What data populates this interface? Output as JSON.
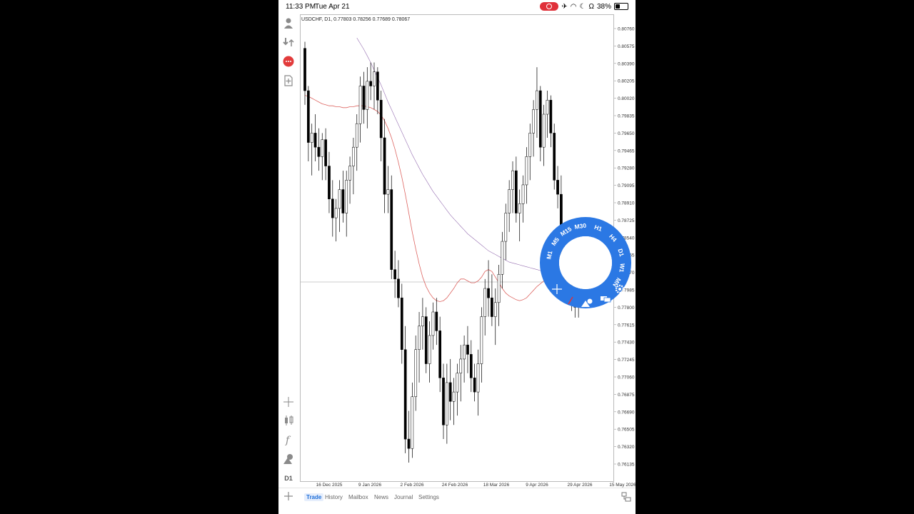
{
  "status_bar": {
    "time": "11:33 PM",
    "date": "Tue Apr 21",
    "battery": "38%"
  },
  "chart": {
    "header": "USDCHF, D1, 0.77803 0.78256 0.77689 0.78067",
    "accent_up_color": "#ffffff",
    "accent_down_color": "#000000",
    "ma_fast_color": "#d9534f",
    "ma_slow_color": "#8b5fa8"
  },
  "chart_data": {
    "type": "candlestick",
    "symbol": "USDCHF",
    "timeframe": "D1",
    "y_ticks": [
      "0.80760",
      "0.80575",
      "0.80390",
      "0.80205",
      "0.80020",
      "0.79835",
      "0.79650",
      "0.79465",
      "0.79280",
      "0.79095",
      "0.78910",
      "0.78725",
      "0.78540",
      "0.78355",
      "0.78170",
      "0.77985",
      "0.77800",
      "0.77615",
      "0.77430",
      "0.77245",
      "0.77060",
      "0.76875",
      "0.76690",
      "0.76505",
      "0.76320",
      "0.76135"
    ],
    "x_ticks": [
      "16 Dec 2025",
      "9 Jan 2026",
      "2 Feb 2026",
      "24 Feb 2026",
      "18 Mar 2026",
      "9 Apr 2026",
      "29 Apr 2026",
      "15 May 2026"
    ],
    "ylim": [
      0.7605,
      0.8085
    ],
    "ohlc": [
      [
        0.8055,
        0.8062,
        0.7995,
        0.801
      ],
      [
        0.801,
        0.8015,
        0.7935,
        0.7955
      ],
      [
        0.7955,
        0.7975,
        0.792,
        0.7965
      ],
      [
        0.7965,
        0.7985,
        0.7935,
        0.795
      ],
      [
        0.795,
        0.797,
        0.7925,
        0.794
      ],
      [
        0.794,
        0.7965,
        0.7915,
        0.7958
      ],
      [
        0.7958,
        0.797,
        0.7915,
        0.793
      ],
      [
        0.793,
        0.7945,
        0.788,
        0.7895
      ],
      [
        0.7895,
        0.7915,
        0.7855,
        0.7875
      ],
      [
        0.7875,
        0.7895,
        0.785,
        0.7885
      ],
      [
        0.7885,
        0.7915,
        0.786,
        0.7905
      ],
      [
        0.7905,
        0.7925,
        0.787,
        0.788
      ],
      [
        0.788,
        0.7925,
        0.7855,
        0.7915
      ],
      [
        0.7915,
        0.794,
        0.789,
        0.793
      ],
      [
        0.793,
        0.796,
        0.79,
        0.795
      ],
      [
        0.795,
        0.7985,
        0.7925,
        0.7975
      ],
      [
        0.7975,
        0.8025,
        0.7955,
        0.8015
      ],
      [
        0.8015,
        0.803,
        0.7975,
        0.799
      ],
      [
        0.799,
        0.8035,
        0.797,
        0.802
      ],
      [
        0.802,
        0.804,
        0.8,
        0.8015
      ],
      [
        0.8015,
        0.804,
        0.799,
        0.803
      ],
      [
        0.803,
        0.8035,
        0.7985,
        0.8
      ],
      [
        0.8,
        0.801,
        0.7935,
        0.796
      ],
      [
        0.796,
        0.798,
        0.788,
        0.79
      ],
      [
        0.79,
        0.793,
        0.788,
        0.7905
      ],
      [
        0.7905,
        0.792,
        0.781,
        0.782
      ],
      [
        0.782,
        0.784,
        0.779,
        0.781
      ],
      [
        0.781,
        0.783,
        0.778,
        0.779
      ],
      [
        0.779,
        0.7805,
        0.772,
        0.7735
      ],
      [
        0.7735,
        0.776,
        0.7625,
        0.764
      ],
      [
        0.764,
        0.767,
        0.7615,
        0.763
      ],
      [
        0.763,
        0.77,
        0.762,
        0.7685
      ],
      [
        0.7685,
        0.775,
        0.767,
        0.7735
      ],
      [
        0.7735,
        0.7775,
        0.77,
        0.776
      ],
      [
        0.776,
        0.779,
        0.7735,
        0.777
      ],
      [
        0.777,
        0.778,
        0.771,
        0.772
      ],
      [
        0.772,
        0.7765,
        0.77,
        0.775
      ],
      [
        0.775,
        0.7785,
        0.7735,
        0.7775
      ],
      [
        0.7775,
        0.779,
        0.774,
        0.7755
      ],
      [
        0.7755,
        0.777,
        0.769,
        0.7705
      ],
      [
        0.7705,
        0.772,
        0.764,
        0.7655
      ],
      [
        0.7655,
        0.772,
        0.7635,
        0.77
      ],
      [
        0.77,
        0.7725,
        0.766,
        0.768
      ],
      [
        0.768,
        0.7705,
        0.7655,
        0.769
      ],
      [
        0.769,
        0.772,
        0.7665,
        0.771
      ],
      [
        0.771,
        0.774,
        0.768,
        0.7725
      ],
      [
        0.7725,
        0.775,
        0.77,
        0.774
      ],
      [
        0.774,
        0.776,
        0.771,
        0.773
      ],
      [
        0.773,
        0.7745,
        0.769,
        0.7705
      ],
      [
        0.7705,
        0.772,
        0.768,
        0.769
      ],
      [
        0.769,
        0.7735,
        0.7665,
        0.772
      ],
      [
        0.772,
        0.778,
        0.77,
        0.777
      ],
      [
        0.777,
        0.781,
        0.775,
        0.78
      ],
      [
        0.78,
        0.783,
        0.777,
        0.779
      ],
      [
        0.779,
        0.7815,
        0.776,
        0.777
      ],
      [
        0.777,
        0.78,
        0.774,
        0.7785
      ],
      [
        0.7785,
        0.7825,
        0.776,
        0.7815
      ],
      [
        0.7815,
        0.786,
        0.78,
        0.785
      ],
      [
        0.785,
        0.789,
        0.783,
        0.788
      ],
      [
        0.788,
        0.7915,
        0.786,
        0.7905
      ],
      [
        0.7905,
        0.7935,
        0.788,
        0.7925
      ],
      [
        0.7925,
        0.794,
        0.787,
        0.788
      ],
      [
        0.788,
        0.7905,
        0.785,
        0.789
      ],
      [
        0.789,
        0.792,
        0.787,
        0.791
      ],
      [
        0.791,
        0.795,
        0.789,
        0.794
      ],
      [
        0.794,
        0.7975,
        0.7915,
        0.7965
      ],
      [
        0.7965,
        0.8,
        0.794,
        0.799
      ],
      [
        0.799,
        0.8035,
        0.796,
        0.801
      ],
      [
        0.801,
        0.8015,
        0.7935,
        0.795
      ],
      [
        0.795,
        0.7995,
        0.793,
        0.7985
      ],
      [
        0.7985,
        0.801,
        0.796,
        0.8
      ],
      [
        0.8,
        0.8005,
        0.795,
        0.7965
      ],
      [
        0.7965,
        0.7975,
        0.7905,
        0.7915
      ],
      [
        0.7915,
        0.793,
        0.7885,
        0.79
      ],
      [
        0.79,
        0.792,
        0.782,
        0.7835
      ],
      [
        0.7835,
        0.785,
        0.779,
        0.7805
      ],
      [
        0.7805,
        0.783,
        0.779,
        0.781
      ],
      [
        0.781,
        0.7815,
        0.7776,
        0.779
      ],
      [
        0.779,
        0.78,
        0.7769,
        0.778
      ],
      [
        0.778,
        0.7826,
        0.7769,
        0.7807
      ]
    ],
    "series": [
      {
        "color": "#d9534f",
        "values": [
          0.8005,
          0.8004,
          0.8002,
          0.8,
          0.7998,
          0.7996,
          0.7995,
          0.7994,
          0.7994,
          0.7993,
          0.7993,
          0.7992,
          0.7992,
          0.7993,
          0.7993,
          0.7994,
          0.7994,
          0.7994,
          0.7993,
          0.7992,
          0.799,
          0.7988,
          0.7984,
          0.7978,
          0.797,
          0.796,
          0.7948,
          0.7934,
          0.7918,
          0.79,
          0.788,
          0.786,
          0.7842,
          0.7826,
          0.7812,
          0.7802,
          0.7795,
          0.779,
          0.7787,
          0.7786,
          0.7787,
          0.779,
          0.7795,
          0.78,
          0.7806,
          0.781,
          0.781,
          0.7808,
          0.7806,
          0.7806,
          0.7808,
          0.7812,
          0.7818,
          0.782,
          0.7818,
          0.7812,
          0.7806,
          0.78,
          0.7795,
          0.7792,
          0.779,
          0.7788,
          0.7787,
          0.7788,
          0.779,
          0.7794,
          0.7798,
          0.7802,
          0.7805,
          0.7808,
          0.781,
          0.7811,
          0.7812,
          0.7813,
          0.7813,
          0.7812,
          0.7812,
          0.7811,
          0.781,
          0.7809
        ]
      },
      {
        "color": "#8b5fa8",
        "values": [
          null,
          null,
          null,
          null,
          null,
          null,
          null,
          null,
          null,
          null,
          null,
          null,
          null,
          null,
          null,
          0.8066,
          0.806,
          0.8054,
          0.8047,
          0.804,
          0.8032,
          0.8024,
          0.8016,
          0.8007,
          0.7998,
          0.799,
          0.7982,
          0.7974,
          0.7966,
          0.7958,
          0.795,
          0.7942,
          0.7935,
          0.7928,
          0.7921,
          0.7915,
          0.7909,
          0.7903,
          0.7898,
          0.7893,
          0.7888,
          0.7883,
          0.7878,
          0.7874,
          0.787,
          0.7866,
          0.7862,
          0.7858,
          0.7855,
          0.7852,
          0.7849,
          0.7846,
          0.7843,
          0.784,
          0.7838,
          0.7836,
          0.7834,
          0.7832,
          0.783,
          0.7828,
          0.7827,
          0.7826,
          0.7825,
          0.7824,
          0.7823,
          0.7822,
          0.7821,
          0.782,
          0.7819,
          0.7818,
          0.7817,
          0.7816,
          0.7815,
          0.7814,
          0.7813,
          0.7812,
          0.7811,
          0.781,
          0.7809,
          0.7808
        ]
      }
    ],
    "current_price": 0.78067
  },
  "timeframes": [
    "M1",
    "M5",
    "M15",
    "M30",
    "H1",
    "H4",
    "D1",
    "W1",
    "MN"
  ],
  "left_toolbar": [
    "D1"
  ],
  "tabs": [
    "Trade",
    "History",
    "Mailbox",
    "News",
    "Journal",
    "Settings"
  ],
  "active_tab": "Trade"
}
